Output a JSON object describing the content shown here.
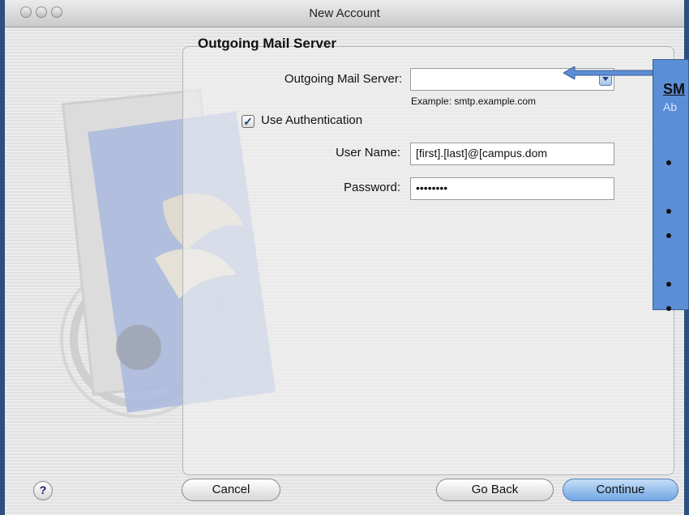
{
  "window": {
    "title": "New Account"
  },
  "section_title": "Outgoing Mail Server",
  "fields": {
    "outgoing_server_label": "Outgoing Mail Server:",
    "outgoing_server_value": "",
    "example": "Example: smtp.example.com",
    "use_auth_label": "Use Authentication",
    "use_auth_checked": true,
    "username_label": "User Name:",
    "username_value": "[first].[last]@[campus.dom",
    "password_label": "Password:",
    "password_value": "••••••••"
  },
  "buttons": {
    "help": "?",
    "cancel": "Cancel",
    "go_back": "Go Back",
    "continue": "Continue"
  },
  "callout": {
    "title": "SM",
    "subtitle": "Ab"
  },
  "colors": {
    "callout_bg": "#5b8ed6",
    "default_button": "#6fa6e3"
  },
  "icons": [
    "mail-stamp-illustration",
    "dropdown-arrow-icon",
    "checkmark-icon",
    "help-icon",
    "arrow-icon"
  ]
}
